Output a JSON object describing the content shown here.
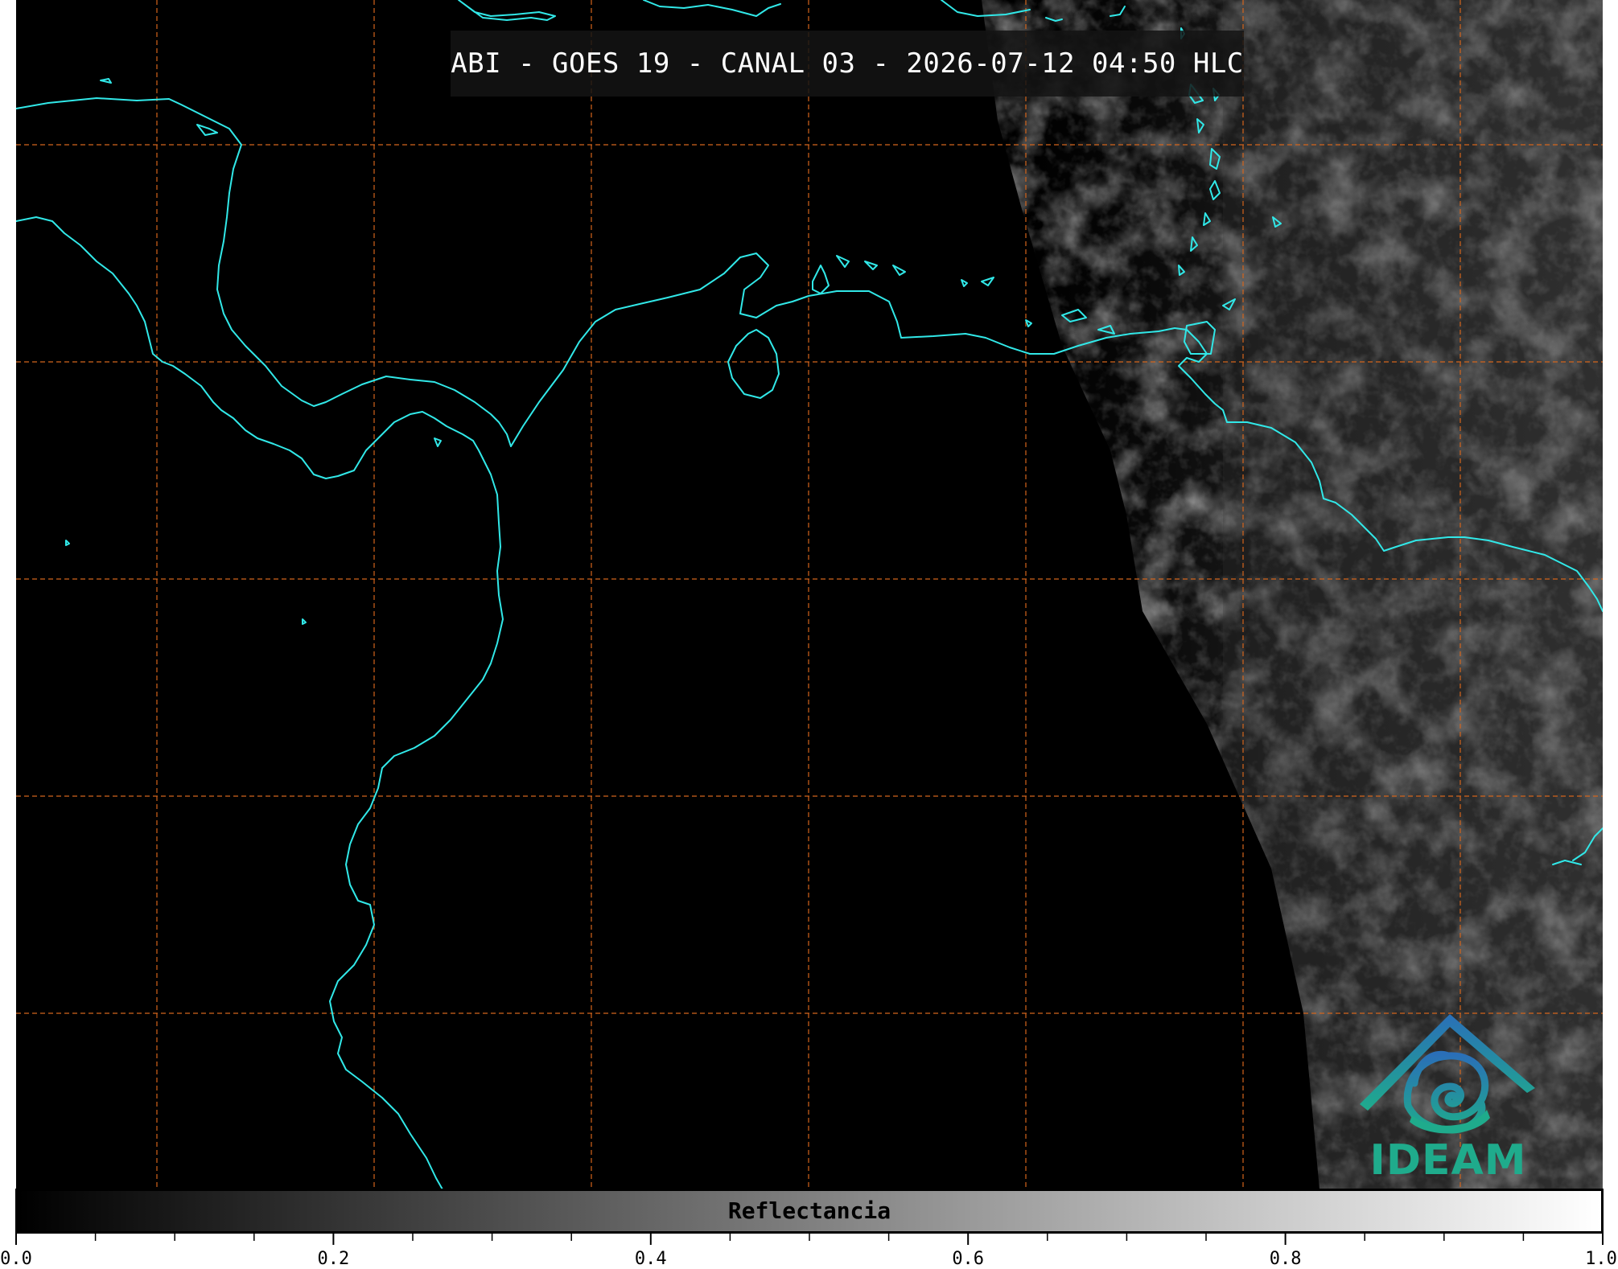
{
  "title": "ABI - GOES 19 - CANAL 03 - 2026-07-12 04:50 HLC",
  "colorbar": {
    "label": "Reflectancia",
    "range": [
      0.0,
      1.0
    ],
    "colors": [
      "#000000",
      "#ffffff"
    ],
    "tick_labels": [
      "0.0",
      "0.2",
      "0.4",
      "0.6",
      "0.8",
      "1.0"
    ]
  },
  "logo": {
    "text": "IDEAM",
    "colors": [
      "#2a6fb8",
      "#1fab8c"
    ]
  },
  "map": {
    "coastline_color": "#31e8e8",
    "grid_color": "#d4651c",
    "grid_style": "dashed",
    "background": "#000000"
  }
}
